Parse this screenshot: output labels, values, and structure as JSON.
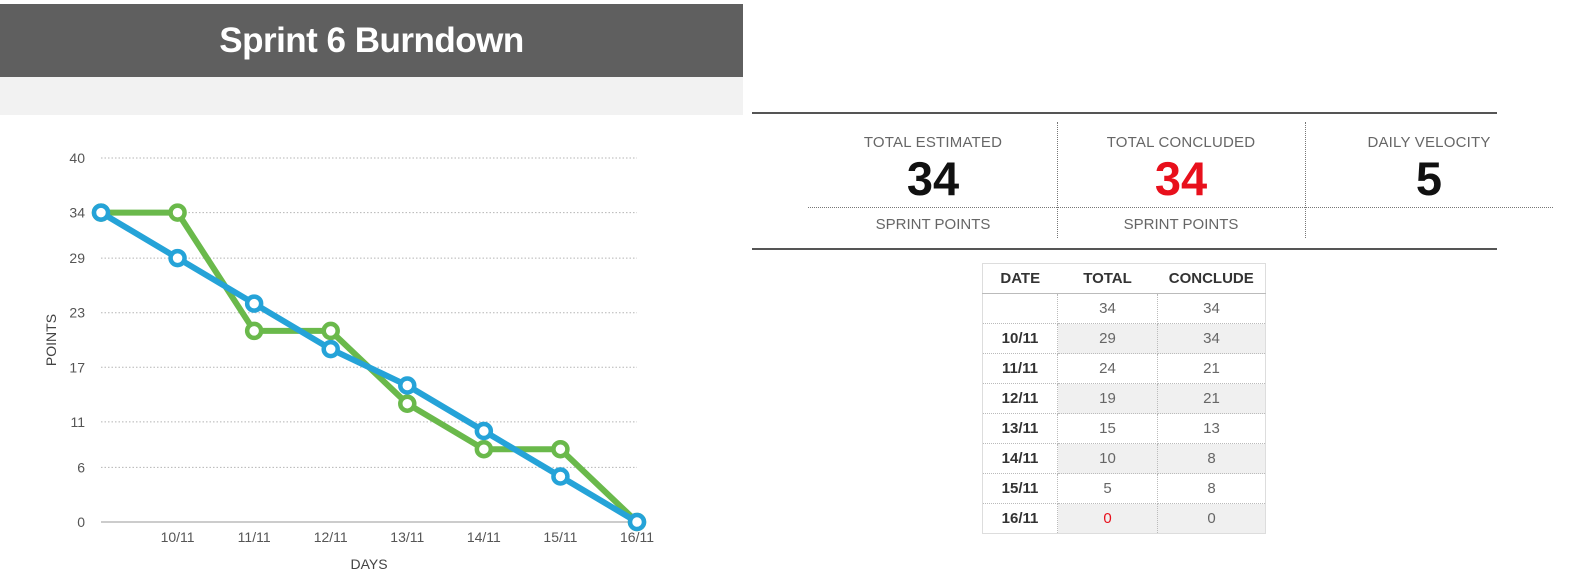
{
  "header": {
    "title": "Sprint 6 Burndown"
  },
  "chart_data": {
    "type": "line",
    "xlabel": "DAYS",
    "ylabel": "POINTS",
    "categories": [
      "",
      "10/11",
      "11/11",
      "12/11",
      "13/11",
      "14/11",
      "15/11",
      "16/11"
    ],
    "yticks": [
      0,
      6,
      11,
      17,
      23,
      29,
      34,
      40
    ],
    "ylim": [
      0,
      40
    ],
    "grid": true,
    "series": [
      {
        "color": "#6ab94b",
        "values": [
          34,
          34,
          21,
          21,
          13,
          8,
          8,
          0
        ]
      },
      {
        "color": "#25a3d8",
        "values": [
          34,
          29,
          24,
          19,
          15,
          10,
          5,
          0
        ]
      }
    ]
  },
  "stats": {
    "estimated": {
      "label": "TOTAL ESTIMATED",
      "value": "34",
      "unit": "SPRINT POINTS"
    },
    "concluded": {
      "label": "TOTAL CONCLUDED",
      "value": "34",
      "unit": "SPRINT POINTS",
      "color": "#e8101c"
    },
    "velocity": {
      "label": "DAILY VELOCITY",
      "value": "5"
    }
  },
  "table": {
    "headers": [
      "DATE",
      "TOTAL",
      "CONCLUDE"
    ],
    "rows": [
      [
        "",
        "34",
        "34"
      ],
      [
        "10/11",
        "29",
        "34"
      ],
      [
        "11/11",
        "24",
        "21"
      ],
      [
        "12/11",
        "19",
        "21"
      ],
      [
        "13/11",
        "15",
        "13"
      ],
      [
        "14/11",
        "10",
        "8"
      ],
      [
        "15/11",
        "5",
        "8"
      ],
      [
        "16/11",
        "0",
        "0"
      ]
    ]
  }
}
